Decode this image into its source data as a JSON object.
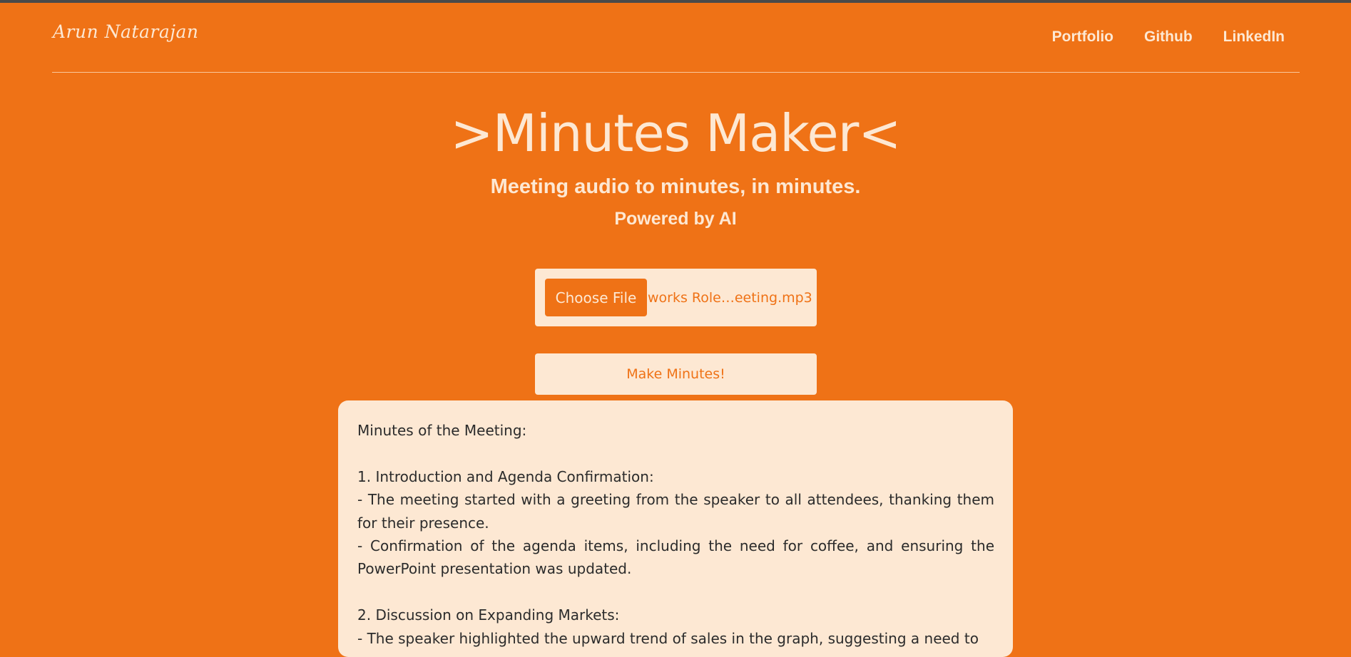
{
  "header": {
    "logo": "Arun Natarajan",
    "nav": [
      "Portfolio",
      "Github",
      "LinkedIn"
    ]
  },
  "hero": {
    "title": ">Minutes Maker<",
    "subtitle": "Meeting audio to minutes, in minutes.",
    "powered": "Powered by AI"
  },
  "upload": {
    "choose_label": "Choose File",
    "file_name": "works Role…eeting.mp3"
  },
  "make_button": "Make Minutes!",
  "minutes": {
    "heading": "Minutes of the Meeting:",
    "lines": [
      "1. Introduction and Agenda Confirmation:",
      "- The meeting started with a greeting from the speaker to all attendees, thanking them for their presence.",
      "- Confirmation of the agenda items, including the need for coffee, and ensuring the PowerPoint presentation was updated.",
      "2. Discussion on Expanding Markets:",
      "- The speaker highlighted the upward trend of sales in the graph, suggesting a need to"
    ]
  },
  "colors": {
    "background": "#ef7216",
    "cream": "#fde8d3",
    "text": "#2b2b2b"
  }
}
